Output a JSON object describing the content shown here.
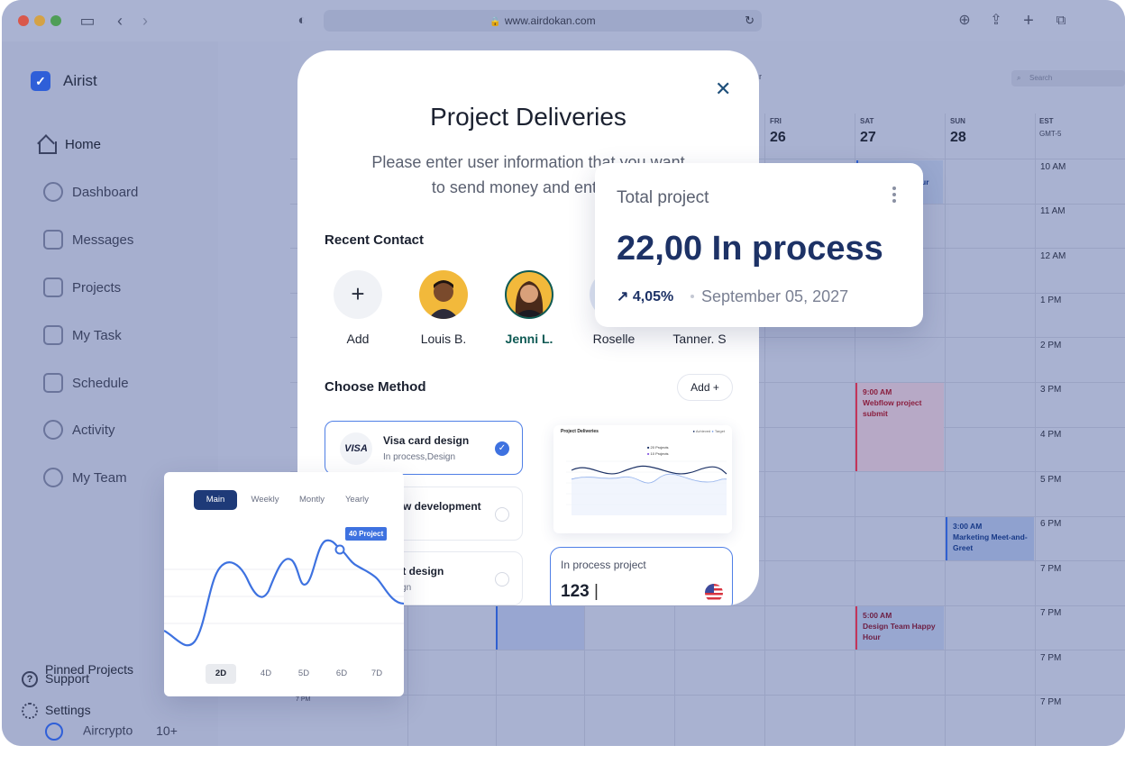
{
  "browser": {
    "url": "www.airdokan.com"
  },
  "sidebar": {
    "brand": "Airist",
    "items": [
      {
        "label": "Home"
      },
      {
        "label": "Dashboard"
      },
      {
        "label": "Messages"
      },
      {
        "label": "Projects"
      },
      {
        "label": "My Task"
      },
      {
        "label": "Schedule"
      },
      {
        "label": "Activity"
      },
      {
        "label": "My Team"
      }
    ],
    "pinned_title": "Pinned Projects",
    "support": "Support",
    "settings": "Settings",
    "pinned_item": "Aircrypto",
    "pinned_count": "10+"
  },
  "calendar": {
    "search_placeholder": "Search",
    "days": [
      {
        "dow": "FRI",
        "date": "26"
      },
      {
        "dow": "SAT",
        "date": "27"
      },
      {
        "dow": "SUN",
        "date": "28"
      }
    ],
    "tz_label": "EST",
    "tz_offset": "GMT-5",
    "times": [
      "10 AM",
      "11 AM",
      "12 AM",
      "1 PM",
      "2 PM",
      "3 PM",
      "4 PM",
      "5 PM",
      "6 PM",
      "7 PM",
      "7 PM",
      "7 PM",
      "7 PM"
    ],
    "left_time": "7 PM",
    "partial_header": "r",
    "partial_event": "ur",
    "events": [
      {
        "time": "9:00 AM",
        "title": "Webflow project submit"
      },
      {
        "time": "3:00 AM",
        "title": "Marketing Meet-and-Greet"
      },
      {
        "time": "5:00 AM",
        "title": "Design Team Happy Hour"
      }
    ]
  },
  "modal": {
    "title": "Project Deliveries",
    "subtitle_line1": "Please enter user information that you want",
    "subtitle_line2": "to send money and enter a",
    "recent_contact": "Recent Contact",
    "contacts": [
      {
        "name": "Add"
      },
      {
        "name": "Louis B."
      },
      {
        "name": "Jenni L."
      },
      {
        "name": "Roselle"
      },
      {
        "name": "Tanner. S"
      }
    ],
    "choose_method": "Choose Method",
    "add_label": "Add",
    "methods": [
      {
        "logo": "VISA",
        "title": "Visa card design",
        "sub": "In process,Design"
      },
      {
        "title": "oflow development",
        "sub": "gn"
      },
      {
        "title": "duct design",
        "sub": "Design"
      }
    ],
    "mini_chart": {
      "title": "Project Deliveries",
      "legend": [
        "Achieved",
        "Target"
      ],
      "tooltip": [
        "20 Projects",
        "10 Projects"
      ]
    },
    "in_process_label": "In process project",
    "in_process_value": "123"
  },
  "total_card": {
    "label": "Total project",
    "value": "22,00 In process",
    "change": "4,05%",
    "date": "September 05, 2027"
  },
  "overview_card": {
    "tabs": [
      "Main",
      "Weekly",
      "Montly",
      "Yearly"
    ],
    "active_tab": "Main",
    "badge": "40 Project",
    "ranges": [
      "2D",
      "4D",
      "5D",
      "6D",
      "7D"
    ],
    "active_range": "2D"
  },
  "colors": {
    "accent": "#3e72e0",
    "navy": "#1d3266",
    "selected_contact": "#0e5a54"
  }
}
